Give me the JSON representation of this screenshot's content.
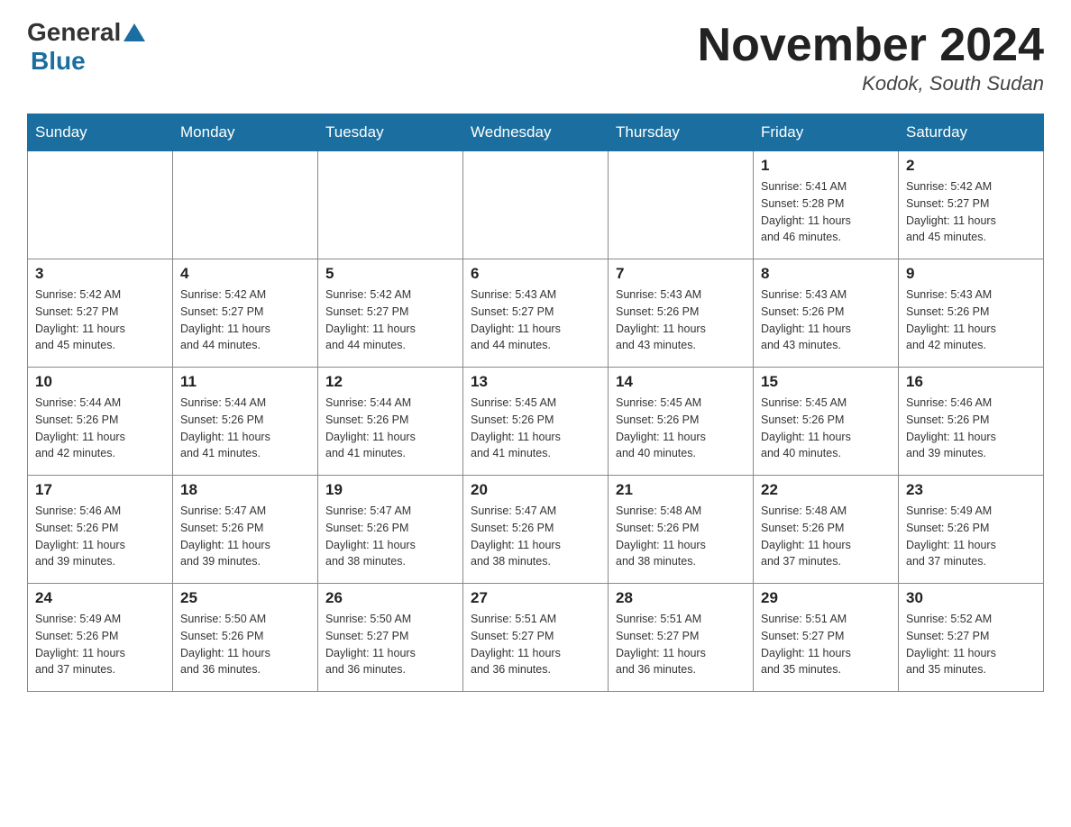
{
  "header": {
    "logo_general": "General",
    "logo_blue": "Blue",
    "month_title": "November 2024",
    "location": "Kodok, South Sudan"
  },
  "weekdays": [
    "Sunday",
    "Monday",
    "Tuesday",
    "Wednesday",
    "Thursday",
    "Friday",
    "Saturday"
  ],
  "rows": [
    [
      {
        "day": "",
        "info": ""
      },
      {
        "day": "",
        "info": ""
      },
      {
        "day": "",
        "info": ""
      },
      {
        "day": "",
        "info": ""
      },
      {
        "day": "",
        "info": ""
      },
      {
        "day": "1",
        "info": "Sunrise: 5:41 AM\nSunset: 5:28 PM\nDaylight: 11 hours\nand 46 minutes."
      },
      {
        "day": "2",
        "info": "Sunrise: 5:42 AM\nSunset: 5:27 PM\nDaylight: 11 hours\nand 45 minutes."
      }
    ],
    [
      {
        "day": "3",
        "info": "Sunrise: 5:42 AM\nSunset: 5:27 PM\nDaylight: 11 hours\nand 45 minutes."
      },
      {
        "day": "4",
        "info": "Sunrise: 5:42 AM\nSunset: 5:27 PM\nDaylight: 11 hours\nand 44 minutes."
      },
      {
        "day": "5",
        "info": "Sunrise: 5:42 AM\nSunset: 5:27 PM\nDaylight: 11 hours\nand 44 minutes."
      },
      {
        "day": "6",
        "info": "Sunrise: 5:43 AM\nSunset: 5:27 PM\nDaylight: 11 hours\nand 44 minutes."
      },
      {
        "day": "7",
        "info": "Sunrise: 5:43 AM\nSunset: 5:26 PM\nDaylight: 11 hours\nand 43 minutes."
      },
      {
        "day": "8",
        "info": "Sunrise: 5:43 AM\nSunset: 5:26 PM\nDaylight: 11 hours\nand 43 minutes."
      },
      {
        "day": "9",
        "info": "Sunrise: 5:43 AM\nSunset: 5:26 PM\nDaylight: 11 hours\nand 42 minutes."
      }
    ],
    [
      {
        "day": "10",
        "info": "Sunrise: 5:44 AM\nSunset: 5:26 PM\nDaylight: 11 hours\nand 42 minutes."
      },
      {
        "day": "11",
        "info": "Sunrise: 5:44 AM\nSunset: 5:26 PM\nDaylight: 11 hours\nand 41 minutes."
      },
      {
        "day": "12",
        "info": "Sunrise: 5:44 AM\nSunset: 5:26 PM\nDaylight: 11 hours\nand 41 minutes."
      },
      {
        "day": "13",
        "info": "Sunrise: 5:45 AM\nSunset: 5:26 PM\nDaylight: 11 hours\nand 41 minutes."
      },
      {
        "day": "14",
        "info": "Sunrise: 5:45 AM\nSunset: 5:26 PM\nDaylight: 11 hours\nand 40 minutes."
      },
      {
        "day": "15",
        "info": "Sunrise: 5:45 AM\nSunset: 5:26 PM\nDaylight: 11 hours\nand 40 minutes."
      },
      {
        "day": "16",
        "info": "Sunrise: 5:46 AM\nSunset: 5:26 PM\nDaylight: 11 hours\nand 39 minutes."
      }
    ],
    [
      {
        "day": "17",
        "info": "Sunrise: 5:46 AM\nSunset: 5:26 PM\nDaylight: 11 hours\nand 39 minutes."
      },
      {
        "day": "18",
        "info": "Sunrise: 5:47 AM\nSunset: 5:26 PM\nDaylight: 11 hours\nand 39 minutes."
      },
      {
        "day": "19",
        "info": "Sunrise: 5:47 AM\nSunset: 5:26 PM\nDaylight: 11 hours\nand 38 minutes."
      },
      {
        "day": "20",
        "info": "Sunrise: 5:47 AM\nSunset: 5:26 PM\nDaylight: 11 hours\nand 38 minutes."
      },
      {
        "day": "21",
        "info": "Sunrise: 5:48 AM\nSunset: 5:26 PM\nDaylight: 11 hours\nand 38 minutes."
      },
      {
        "day": "22",
        "info": "Sunrise: 5:48 AM\nSunset: 5:26 PM\nDaylight: 11 hours\nand 37 minutes."
      },
      {
        "day": "23",
        "info": "Sunrise: 5:49 AM\nSunset: 5:26 PM\nDaylight: 11 hours\nand 37 minutes."
      }
    ],
    [
      {
        "day": "24",
        "info": "Sunrise: 5:49 AM\nSunset: 5:26 PM\nDaylight: 11 hours\nand 37 minutes."
      },
      {
        "day": "25",
        "info": "Sunrise: 5:50 AM\nSunset: 5:26 PM\nDaylight: 11 hours\nand 36 minutes."
      },
      {
        "day": "26",
        "info": "Sunrise: 5:50 AM\nSunset: 5:27 PM\nDaylight: 11 hours\nand 36 minutes."
      },
      {
        "day": "27",
        "info": "Sunrise: 5:51 AM\nSunset: 5:27 PM\nDaylight: 11 hours\nand 36 minutes."
      },
      {
        "day": "28",
        "info": "Sunrise: 5:51 AM\nSunset: 5:27 PM\nDaylight: 11 hours\nand 36 minutes."
      },
      {
        "day": "29",
        "info": "Sunrise: 5:51 AM\nSunset: 5:27 PM\nDaylight: 11 hours\nand 35 minutes."
      },
      {
        "day": "30",
        "info": "Sunrise: 5:52 AM\nSunset: 5:27 PM\nDaylight: 11 hours\nand 35 minutes."
      }
    ]
  ]
}
